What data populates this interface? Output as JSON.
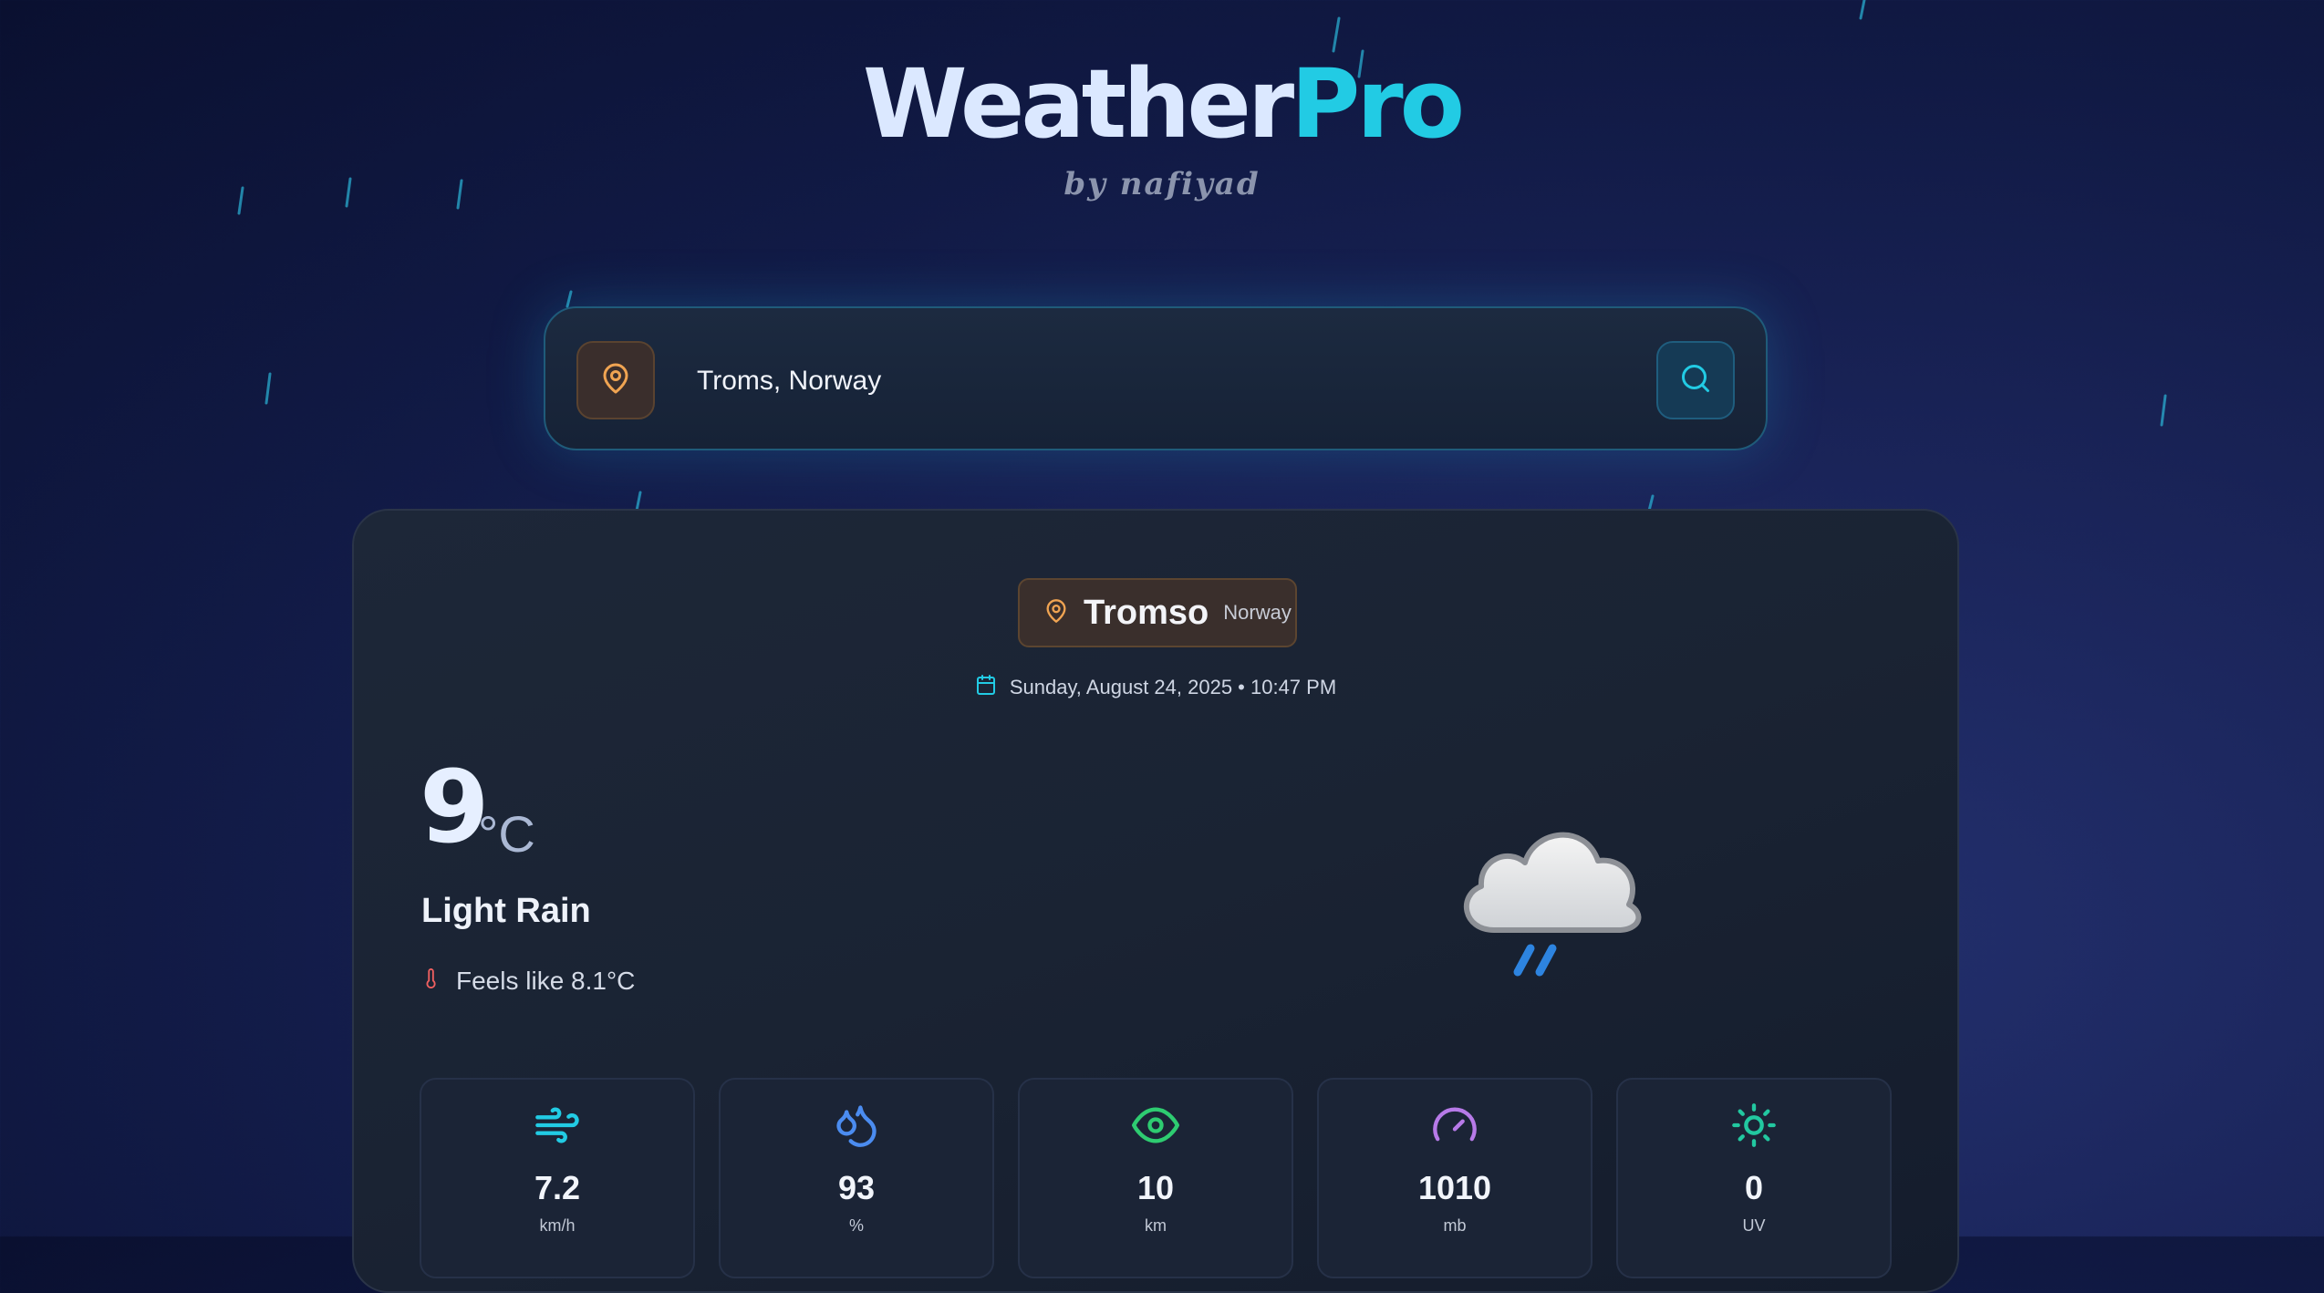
{
  "app": {
    "title_part1": "Weather",
    "title_part2": "Pro",
    "byline": "by nafiyad"
  },
  "search": {
    "value": "Troms, Norway",
    "icons": [
      "map-pin-icon",
      "search-icon"
    ]
  },
  "location": {
    "city": "Tromso",
    "country": "Norway"
  },
  "datetime": "Sunday, August 24, 2025 • 10:47 PM",
  "current": {
    "temperature": "9",
    "unit": "°C",
    "condition": "Light Rain",
    "feels_like": "Feels like 8.1°C",
    "icon": "cloud-rain-icon"
  },
  "stats": [
    {
      "name": "wind",
      "icon": "wind-icon",
      "value": "7.2",
      "unit": "km/h",
      "color": "#22cbe4"
    },
    {
      "name": "humidity",
      "icon": "droplets-icon",
      "value": "93",
      "unit": "%",
      "color": "#4b8cf0"
    },
    {
      "name": "visibility",
      "icon": "eye-icon",
      "value": "10",
      "unit": "km",
      "color": "#2ecc71"
    },
    {
      "name": "pressure",
      "icon": "gauge-icon",
      "value": "1010",
      "unit": "mb",
      "color": "#b77ae8"
    },
    {
      "name": "uv",
      "icon": "sun-icon",
      "value": "0",
      "unit": "UV",
      "color": "#22c8a0"
    }
  ],
  "colors": {
    "accent": "#22cbe4",
    "pin": "#f0a452"
  }
}
